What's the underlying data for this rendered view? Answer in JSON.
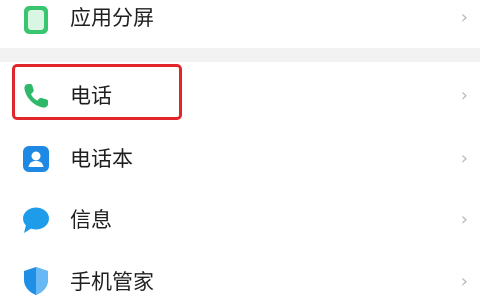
{
  "settings": {
    "items": [
      {
        "label": "应用分屏",
        "icon": "split-screen-icon",
        "color": "#39c46e"
      },
      {
        "label": "电话",
        "icon": "phone-icon",
        "color": "#2fb86a"
      },
      {
        "label": "电话本",
        "icon": "contacts-icon",
        "color": "#1e88e5"
      },
      {
        "label": "信息",
        "icon": "message-icon",
        "color": "#1e9be9"
      },
      {
        "label": "手机管家",
        "icon": "shield-icon",
        "color": "#1f8fe5"
      }
    ],
    "chevron": "›",
    "highlight_color": "#e0262b"
  }
}
